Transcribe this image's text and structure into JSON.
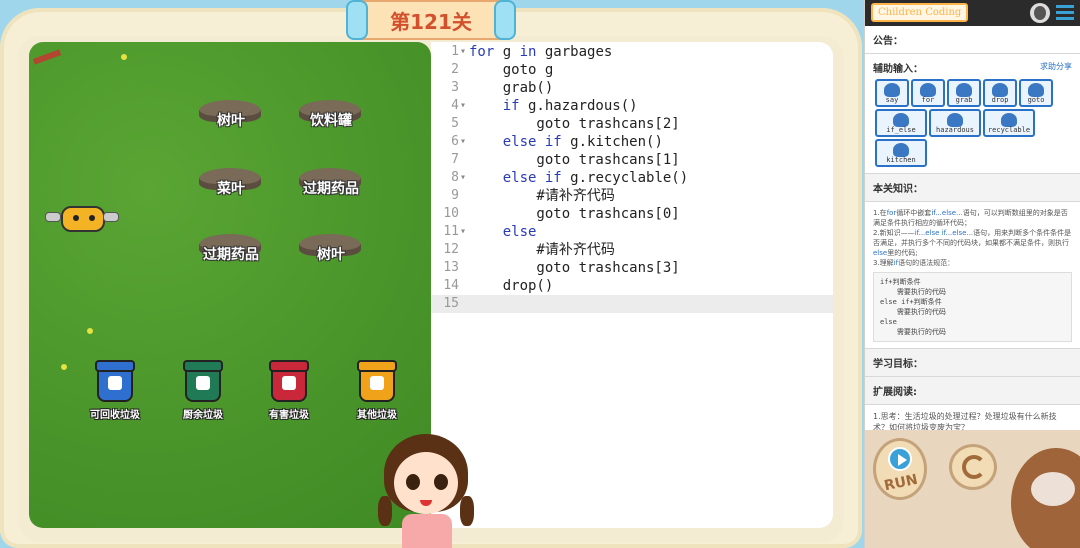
{
  "level": {
    "title": "第121关"
  },
  "garbages": [
    {
      "label": "树叶"
    },
    {
      "label": "饮料罐"
    },
    {
      "label": "菜叶"
    },
    {
      "label": "过期药品"
    },
    {
      "label": "过期药品"
    },
    {
      "label": "树叶"
    }
  ],
  "bins": [
    {
      "label": "可回收垃圾",
      "color": "#2f6fd0"
    },
    {
      "label": "厨余垃圾",
      "color": "#1f7a55"
    },
    {
      "label": "有害垃圾",
      "color": "#c9283a"
    },
    {
      "label": "其他垃圾",
      "color": "#f0a21a"
    }
  ],
  "editor": {
    "lines": [
      {
        "n": "1",
        "fold": "▾",
        "code": "for g in garbages"
      },
      {
        "n": "2",
        "fold": "",
        "code": "    goto g"
      },
      {
        "n": "3",
        "fold": "",
        "code": "    grab()"
      },
      {
        "n": "4",
        "fold": "▾",
        "code": "    if g.hazardous()"
      },
      {
        "n": "5",
        "fold": "",
        "code": "        goto trashcans[2]"
      },
      {
        "n": "6",
        "fold": "▾",
        "code": "    else if g.kitchen()"
      },
      {
        "n": "7",
        "fold": "",
        "code": "        goto trashcans[1]"
      },
      {
        "n": "8",
        "fold": "▾",
        "code": "    else if g.recyclable()"
      },
      {
        "n": "9",
        "fold": "",
        "code": "        #请补齐代码"
      },
      {
        "n": "10",
        "fold": "",
        "code": "        goto trashcans[0]"
      },
      {
        "n": "11",
        "fold": "▾",
        "code": "    else"
      },
      {
        "n": "12",
        "fold": "",
        "code": "        #请补齐代码"
      },
      {
        "n": "13",
        "fold": "",
        "code": "        goto trashcans[3]"
      },
      {
        "n": "14",
        "fold": "",
        "code": "    drop()"
      },
      {
        "n": "15",
        "fold": "",
        "code": ""
      }
    ]
  },
  "panel": {
    "brand": "Children Coding",
    "notice_title": "公告：",
    "assist_title": "辅助输入：",
    "help_link": "求助分享",
    "blocks": [
      {
        "label": "say"
      },
      {
        "label": "for"
      },
      {
        "label": "grab"
      },
      {
        "label": "drop"
      },
      {
        "label": "goto"
      },
      {
        "label": "if_else"
      },
      {
        "label": "hazardous"
      },
      {
        "label": "recyclable"
      },
      {
        "label": "kitchen"
      }
    ],
    "knowledge_title": "本关知识：",
    "knowledge": {
      "p1a": "1.在",
      "p1b": "for",
      "p1c": "循环中嵌套",
      "p1d": "if...else...",
      "p1e": "语句，可以判断数组里的对象是否满足条件执行相应的循环代码；",
      "p2a": "2.新知识——",
      "p2b": "if...else if...else...",
      "p2c": "语句，用来判断多个条件条件是否满足，并执行多个不同的代码块，如果都不满足条件，则执行",
      "p2d": "else",
      "p2e": "里的代码;",
      "p3a": "3.理解",
      "p3b": "if",
      "p3c": "语句的语法规范：",
      "code": [
        "if+判断条件",
        "    需要执行的代码",
        "else if+判断条件",
        "    需要执行的代码",
        "else",
        "    需要执行的代码"
      ]
    },
    "goal_title": "学习目标：",
    "reading_title": "扩展阅读:",
    "reading": "1.思考：生活垃圾的处理过程？处理垃圾有什么新技术？如何将垃圾变废为宝？",
    "run_label": "RUN"
  }
}
